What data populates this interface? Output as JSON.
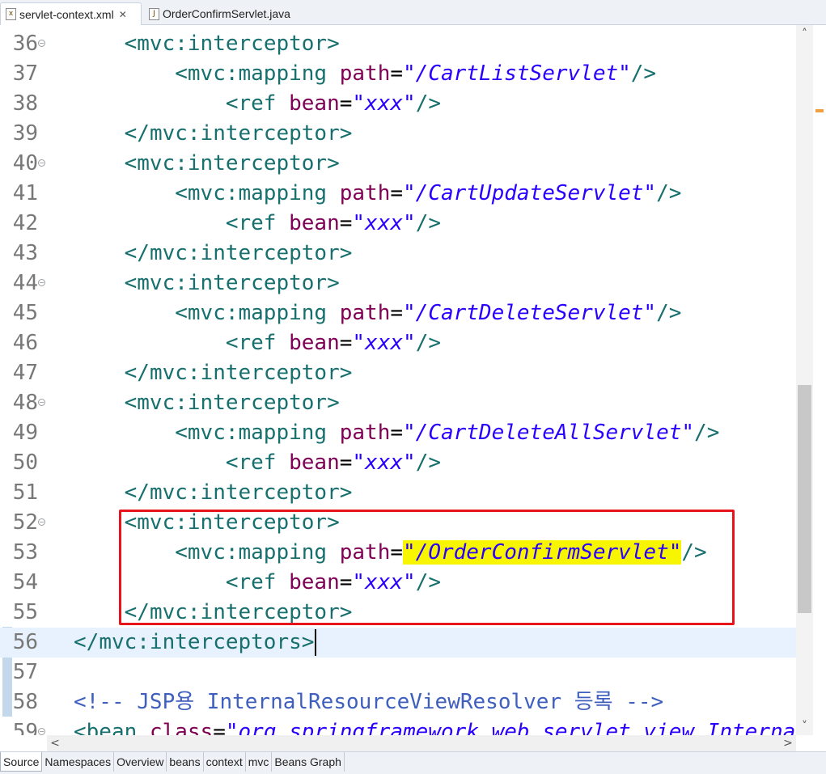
{
  "tabs": {
    "active": {
      "label": "servlet-context.xml",
      "icon": "xml-file-icon",
      "close": "✕"
    },
    "inactive": {
      "label": "OrderConfirmServlet.java",
      "icon": "java-file-icon"
    }
  },
  "editor": {
    "lines": [
      {
        "num": "36",
        "fold": true,
        "indent": 2,
        "kind": "open",
        "tag": "mvc:interceptor"
      },
      {
        "num": "37",
        "fold": false,
        "indent": 4,
        "kind": "mapping",
        "tag": "mvc:mapping",
        "attr": "path",
        "value": "\"/CartListServlet\""
      },
      {
        "num": "38",
        "fold": false,
        "indent": 6,
        "kind": "ref",
        "tag": "ref",
        "attr": "bean",
        "value": "\"xxx\""
      },
      {
        "num": "39",
        "fold": false,
        "indent": 2,
        "kind": "close",
        "tag": "mvc:interceptor"
      },
      {
        "num": "40",
        "fold": true,
        "indent": 2,
        "kind": "open",
        "tag": "mvc:interceptor"
      },
      {
        "num": "41",
        "fold": false,
        "indent": 4,
        "kind": "mapping",
        "tag": "mvc:mapping",
        "attr": "path",
        "value": "\"/CartUpdateServlet\""
      },
      {
        "num": "42",
        "fold": false,
        "indent": 6,
        "kind": "ref",
        "tag": "ref",
        "attr": "bean",
        "value": "\"xxx\""
      },
      {
        "num": "43",
        "fold": false,
        "indent": 2,
        "kind": "close",
        "tag": "mvc:interceptor"
      },
      {
        "num": "44",
        "fold": true,
        "indent": 2,
        "kind": "open",
        "tag": "mvc:interceptor"
      },
      {
        "num": "45",
        "fold": false,
        "indent": 4,
        "kind": "mapping",
        "tag": "mvc:mapping",
        "attr": "path",
        "value": "\"/CartDeleteServlet\""
      },
      {
        "num": "46",
        "fold": false,
        "indent": 6,
        "kind": "ref",
        "tag": "ref",
        "attr": "bean",
        "value": "\"xxx\""
      },
      {
        "num": "47",
        "fold": false,
        "indent": 2,
        "kind": "close",
        "tag": "mvc:interceptor"
      },
      {
        "num": "48",
        "fold": true,
        "indent": 2,
        "kind": "open",
        "tag": "mvc:interceptor"
      },
      {
        "num": "49",
        "fold": false,
        "indent": 4,
        "kind": "mapping",
        "tag": "mvc:mapping",
        "attr": "path",
        "value": "\"/CartDeleteAllServlet\""
      },
      {
        "num": "50",
        "fold": false,
        "indent": 6,
        "kind": "ref",
        "tag": "ref",
        "attr": "bean",
        "value": "\"xxx\""
      },
      {
        "num": "51",
        "fold": false,
        "indent": 2,
        "kind": "close",
        "tag": "mvc:interceptor"
      },
      {
        "num": "52",
        "fold": true,
        "indent": 2,
        "kind": "open",
        "tag": "mvc:interceptor"
      },
      {
        "num": "53",
        "fold": false,
        "indent": 4,
        "kind": "mapping",
        "tag": "mvc:mapping",
        "attr": "path",
        "value": "\"/OrderConfirmServlet\"",
        "highlight": true
      },
      {
        "num": "54",
        "fold": false,
        "indent": 6,
        "kind": "ref",
        "tag": "ref",
        "attr": "bean",
        "value": "\"xxx\""
      },
      {
        "num": "55",
        "fold": false,
        "indent": 2,
        "kind": "close",
        "tag": "mvc:interceptor"
      },
      {
        "num": "56",
        "fold": false,
        "indent": 0,
        "kind": "close",
        "tag": "mvc:interceptors",
        "current": true
      },
      {
        "num": "57",
        "fold": false,
        "indent": 0,
        "kind": "blank"
      },
      {
        "num": "58",
        "fold": false,
        "indent": 0,
        "kind": "comment",
        "text": "<!-- JSP용 InternalResourceViewResolver 등록 -->"
      },
      {
        "num": "59",
        "fold": true,
        "indent": 0,
        "kind": "bean",
        "tag": "bean",
        "attr": "class",
        "value": "\"org.springframework.web.servlet.view.InternalResourceViewResolver\""
      }
    ]
  },
  "scrollbar": {
    "up": "˄",
    "down": "˅",
    "left": "<",
    "right": ">"
  },
  "bottom_tabs": [
    "Source",
    "Namespaces",
    "Overview",
    "beans",
    "context",
    "mvc",
    "Beans Graph"
  ],
  "colors": {
    "tag": "#17706e",
    "attr": "#7f0055",
    "string": "#2a00ff",
    "comment": "#3f5fbf",
    "highlight": "#f7f600",
    "annotation_box": "#e8141c"
  }
}
